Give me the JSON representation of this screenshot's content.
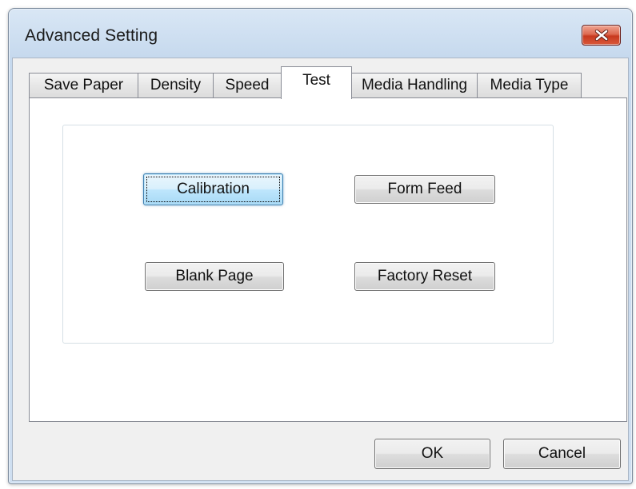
{
  "window": {
    "title": "Advanced Setting"
  },
  "tabs": [
    {
      "label": "Save Paper",
      "active": false
    },
    {
      "label": "Density",
      "active": false
    },
    {
      "label": "Speed",
      "active": false
    },
    {
      "label": "Test",
      "active": true
    },
    {
      "label": "Media Handling",
      "active": false
    },
    {
      "label": "Media Type",
      "active": false
    }
  ],
  "test_panel": {
    "calibration_label": "Calibration",
    "form_feed_label": "Form Feed",
    "blank_page_label": "Blank Page",
    "factory_reset_label": "Factory Reset"
  },
  "footer": {
    "ok_label": "OK",
    "cancel_label": "Cancel"
  },
  "icons": {
    "close": "close-icon"
  },
  "colors": {
    "close_button": "#c8391f",
    "focused_button_border": "#3c7fb1",
    "title_bar": "#c6d9ee"
  }
}
